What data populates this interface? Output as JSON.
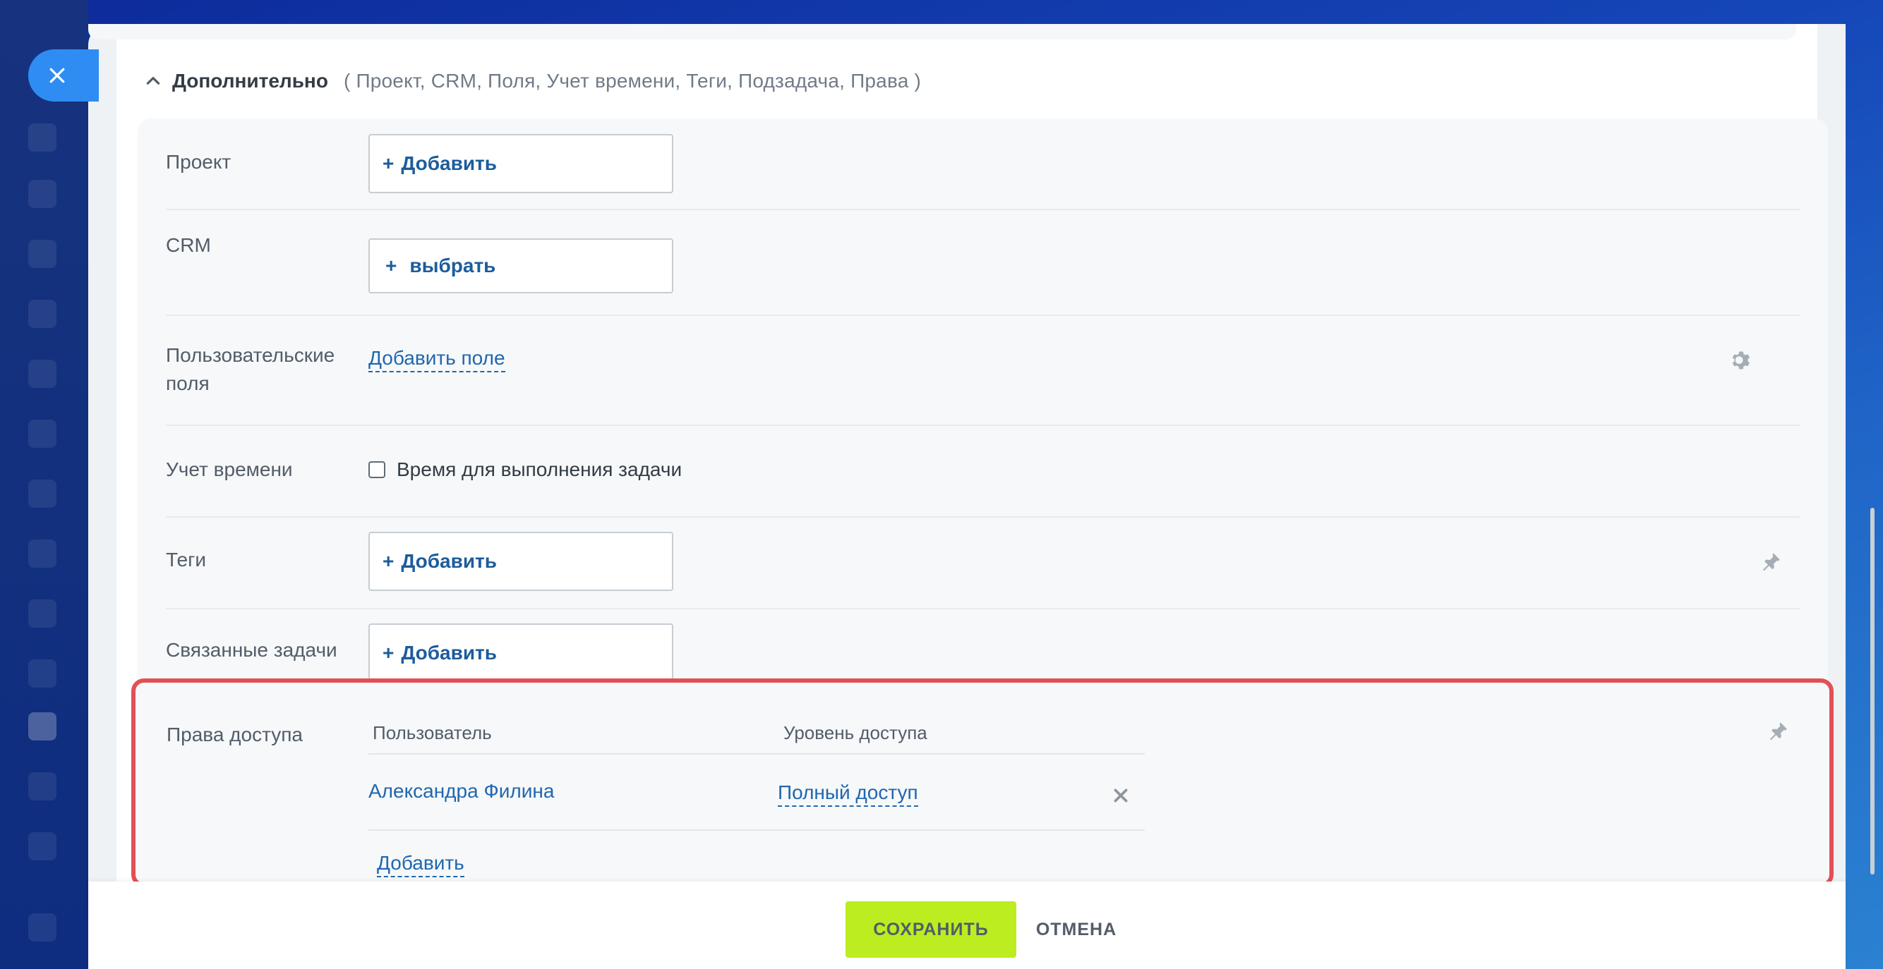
{
  "section": {
    "title": "Дополнительно",
    "subtitle": "( Проект,  CRM,  Поля,  Учет времени,  Теги,  Подзадача,  Права )"
  },
  "rows": {
    "project": {
      "label": "Проект",
      "button": "Добавить"
    },
    "crm": {
      "label": "CRM",
      "button": "выбрать"
    },
    "custom_fields": {
      "label_line1": "Пользовательские",
      "label_line2": "поля",
      "link": "Добавить поле"
    },
    "time_tracking": {
      "label": "Учет времени",
      "checkbox_label": "Время для выполнения задачи",
      "checked": false
    },
    "tags": {
      "label": "Теги",
      "button": "Добавить"
    },
    "related_tasks": {
      "label": "Связанные задачи",
      "button": "Добавить"
    }
  },
  "access": {
    "label": "Права доступа",
    "col_user": "Пользователь",
    "col_level": "Уровень доступа",
    "entries": [
      {
        "user": "Александра Филина",
        "level": "Полный доступ"
      }
    ],
    "add_link": "Добавить"
  },
  "footer": {
    "save": "СОХРАНИТЬ",
    "cancel": "ОТМЕНА"
  },
  "colors": {
    "highlight_border": "#e25056",
    "save_button": "#bbed21",
    "link": "#2067b0",
    "close_button": "#2f8cf3"
  },
  "icons": [
    "close-icon",
    "chevron-up-icon",
    "gear-icon",
    "pin-icon",
    "remove-icon"
  ]
}
